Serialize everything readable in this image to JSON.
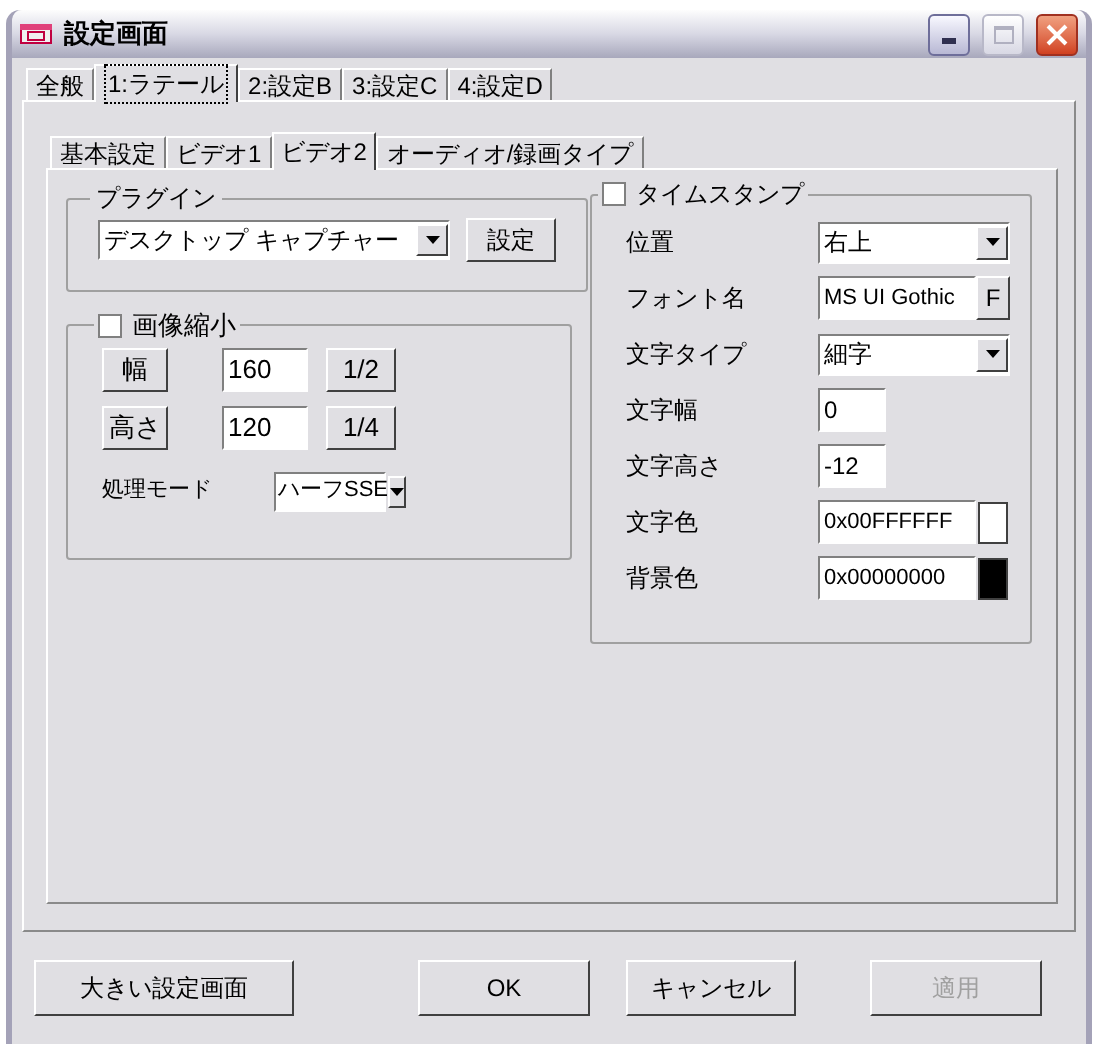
{
  "window": {
    "title": "設定画面"
  },
  "outer_tabs": [
    {
      "label": "全般",
      "selected": false
    },
    {
      "label": "1:ラテール",
      "selected": true
    },
    {
      "label": "2:設定B",
      "selected": false
    },
    {
      "label": "3:設定C",
      "selected": false
    },
    {
      "label": "4:設定D",
      "selected": false
    }
  ],
  "inner_tabs": [
    {
      "label": "基本設定",
      "selected": false
    },
    {
      "label": "ビデオ1",
      "selected": false
    },
    {
      "label": "ビデオ2",
      "selected": true
    },
    {
      "label": "オーディオ/録画タイプ",
      "selected": false
    }
  ],
  "plugin": {
    "label": "プラグイン",
    "value": "デスクトップ キャプチャー",
    "button": "設定"
  },
  "shrink": {
    "label": "画像縮小",
    "checked": false,
    "rows": [
      {
        "button": "幅",
        "value": "160",
        "ratio_button": "1/2"
      },
      {
        "button": "高さ",
        "value": "120",
        "ratio_button": "1/4"
      }
    ],
    "mode_label": "処理モード",
    "mode_value": "ハーフSSE"
  },
  "timestamp": {
    "label": "タイムスタンプ",
    "checked": false,
    "rows": [
      {
        "kind": "dropdown",
        "label": "位置",
        "value": "右上"
      },
      {
        "kind": "font",
        "label": "フォント名",
        "value": "MS UI Gothic",
        "button": "F"
      },
      {
        "kind": "dropdown",
        "label": "文字タイプ",
        "value": "細字"
      },
      {
        "kind": "number",
        "label": "文字幅",
        "value": "0"
      },
      {
        "kind": "number",
        "label": "文字高さ",
        "value": "-12"
      },
      {
        "kind": "color",
        "label": "文字色",
        "value": "0x00FFFFFF",
        "color": "#ffffff"
      },
      {
        "kind": "color",
        "label": "背景色",
        "value": "0x00000000",
        "color": "#000000"
      }
    ]
  },
  "buttons": [
    {
      "label": "大きい設定画面",
      "disabled": false
    },
    {
      "label": "OK",
      "disabled": false
    },
    {
      "label": "キャンセル",
      "disabled": false
    },
    {
      "label": "適用",
      "disabled": true
    }
  ]
}
